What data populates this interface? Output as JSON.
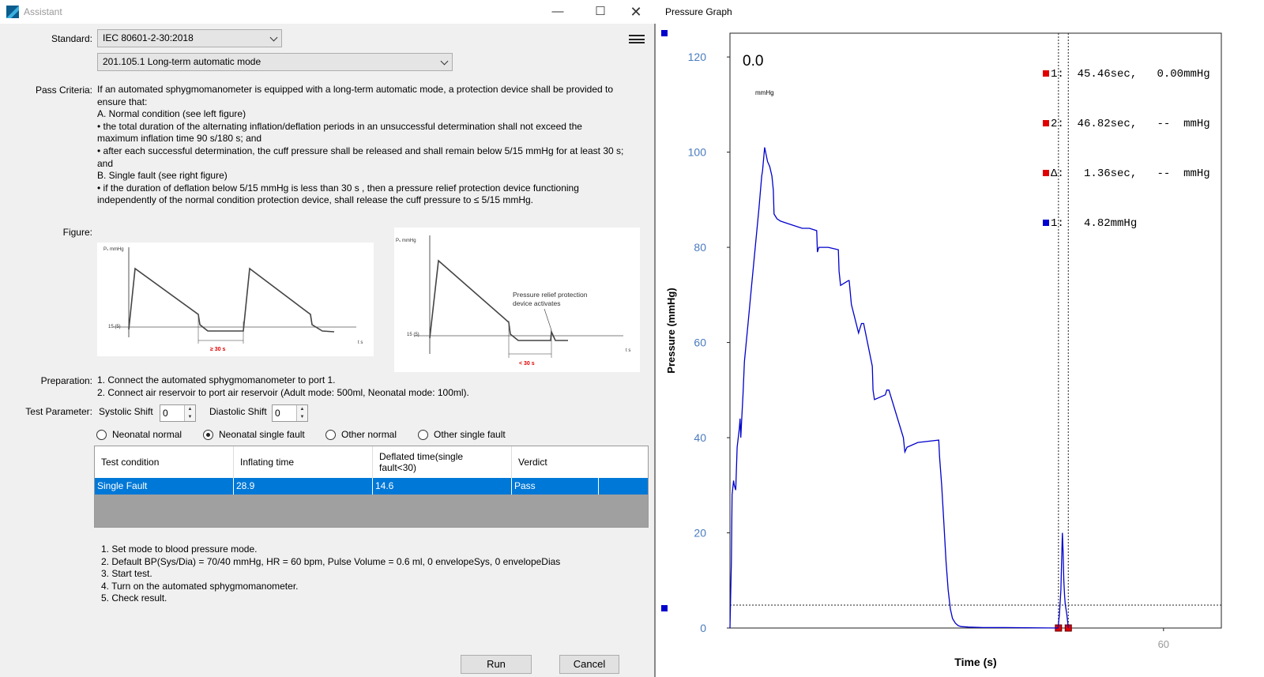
{
  "assistant": {
    "window_title": "Assistant",
    "standard_label": "Standard:",
    "standard_value": "IEC 80601-2-30:2018",
    "clause_value": "201.105.1 Long-term automatic mode",
    "pass_criteria_label": "Pass Criteria:",
    "pass_criteria_lines": [
      "If an automated sphygmomanometer is equipped with a long-term automatic mode, a protection device shall be provided to",
      "ensure that:",
      "A. Normal condition (see left figure)",
      "• the total duration of the alternating inflation/deflation periods in an unsuccessful determination shall not exceed the",
      "maximum inflation time 90 s/180 s; and",
      "• after each successful determination, the cuff pressure shall be released and shall remain below 5/15 mmHg for at least 30 s;",
      "and",
      "B. Single fault (see right figure)",
      "• if the duration of deflation below 5/15 mmHg is less than 30 s , then a pressure relief protection device functioning",
      "independently of the normal condition protection device, shall release the cuff pressure to ≤ 5/15 mmHg."
    ],
    "figure_label": "Figure:",
    "figure_left": {
      "y_label": "Pₛ mmHg",
      "level_label": "15 (5)",
      "interval_label": "≥ 30 s",
      "t_label": "t s"
    },
    "figure_right": {
      "y_label": "Pₛ mmHg",
      "level_label": "15 (5)",
      "interval_label": "< 30 s",
      "annotation_1": "Pressure relief protection",
      "annotation_2": "device activates",
      "t_label": "t s"
    },
    "preparation_label": "Preparation:",
    "preparation_lines": [
      "1. Connect the automated sphygmomanometer to port 1.",
      "2. Connect air reservoir to port air reservoir (Adult mode: 500ml, Neonatal mode: 100ml)."
    ],
    "test_parameter_label": "Test Parameter:",
    "systolic_label": "Systolic Shift",
    "systolic_value": "0",
    "diastolic_label": "Diastolic Shift",
    "diastolic_value": "0",
    "radios": [
      {
        "label": "Neonatal normal",
        "checked": false
      },
      {
        "label": "Neonatal single fault",
        "checked": true
      },
      {
        "label": "Other normal",
        "checked": false
      },
      {
        "label": "Other single fault",
        "checked": false
      }
    ],
    "table": {
      "headers": [
        "Test condition",
        "Inflating time",
        "Deflated time(single",
        "fault<30)",
        "Verdict"
      ],
      "row": [
        "Single Fault",
        "28.9",
        "14.6",
        "Pass"
      ]
    },
    "instructions": [
      "1. Set mode to blood pressure mode.",
      "2. Default BP(Sys/Dia) = 70/40 mmHg, HR = 60 bpm, Pulse Volume = 0.6 ml, 0 envelopeSys, 0 envelopeDias",
      "3. Start test.",
      "4. Turn on the automated sphygmomanometer.",
      "5. Check result."
    ],
    "run_label": "Run",
    "cancel_label": "Cancel"
  },
  "pressure_graph": {
    "window_title": "Pressure Graph",
    "current_value": "0.0",
    "current_unit": "mmHg",
    "cursor_readout": [
      {
        "marker": "1:",
        "time": "45.46sec,",
        "value": "0.00mmHg",
        "color": "#e00000"
      },
      {
        "marker": "2:",
        "time": "46.82sec,",
        "value": "--  mmHg",
        "color": "#e00000"
      },
      {
        "marker": "Δ:",
        "time": " 1.36sec,",
        "value": "--  mmHg",
        "color": "#e00000"
      },
      {
        "marker": "1:",
        "time": " 4.82mmHg",
        "value": "",
        "color": "#0000d0"
      }
    ]
  },
  "chart_data": {
    "type": "line",
    "title": "",
    "xlabel": "Time (s)",
    "ylabel": "Pressure (mmHg)",
    "xlim": [
      0,
      68
    ],
    "ylim": [
      0,
      125
    ],
    "yticks": [
      0,
      20,
      40,
      60,
      80,
      100,
      120
    ],
    "xticks": [
      60
    ],
    "grid": false,
    "cursor_lines_x": [
      45.46,
      46.82
    ],
    "threshold_y": 4.82,
    "line_color": "#0000cc",
    "series": [
      {
        "x": [
          0,
          0.2,
          0.3,
          0.5,
          0.6,
          0.8,
          1.0,
          1.3,
          1.4,
          1.5,
          1.6,
          1.8,
          2.0,
          2.5,
          3.0,
          3.5,
          4.0,
          4.4,
          4.5,
          4.8,
          5.2,
          5.5,
          5.8,
          6.0,
          6.1,
          6.5,
          7.0,
          8.0,
          9.0,
          10.0,
          11.0,
          12.0,
          12.1,
          12.3,
          13.6,
          15.0,
          15.1,
          15.3,
          16.4,
          16.5,
          16.8,
          17.8,
          18.0,
          18.2,
          18.5,
          19.7,
          19.8,
          20.0,
          21.5,
          21.7,
          22.0,
          24.0,
          24.2,
          24.5,
          26.0,
          28.9,
          29.0,
          29.3,
          29.6,
          29.9,
          30.2,
          30.5,
          30.8,
          31.2,
          31.6,
          32.0,
          33.0,
          35.0,
          38.0,
          45.4,
          45.6,
          45.8,
          45.9,
          46.0,
          46.1,
          46.2,
          46.3,
          46.4,
          46.6,
          46.82
        ],
        "y": [
          0,
          14,
          28,
          31,
          30,
          29,
          38,
          42,
          44,
          40,
          43,
          49,
          56,
          64,
          72,
          80,
          88,
          95,
          96,
          101,
          98,
          97,
          95,
          92,
          87,
          86,
          85.5,
          85,
          84.5,
          84,
          84,
          83.5,
          79,
          80,
          80,
          79.5,
          75,
          72,
          73,
          73,
          68,
          62,
          63,
          64,
          64,
          55,
          50,
          48,
          49,
          50,
          50,
          40,
          37,
          38,
          39,
          39.5,
          36,
          30,
          22,
          14,
          8,
          4,
          2,
          1,
          0.5,
          0.3,
          0.2,
          0.1,
          0.1,
          0,
          3,
          8,
          14,
          20,
          16,
          10,
          7,
          5,
          3,
          0
        ]
      }
    ]
  }
}
